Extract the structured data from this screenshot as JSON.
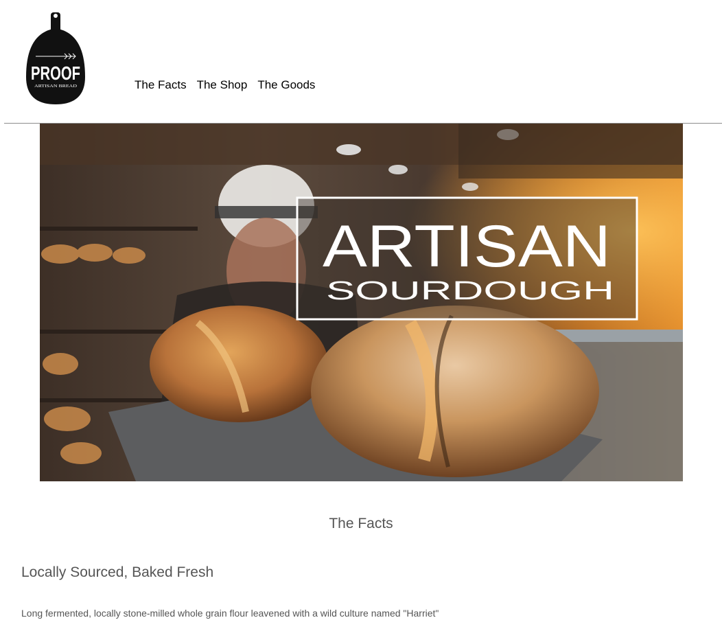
{
  "logo": {
    "brand": "PROOF",
    "tagline": "ARTISAN BREAD",
    "icon": "bread-peel-logo"
  },
  "nav": {
    "items": [
      {
        "label": "The Facts"
      },
      {
        "label": "The Shop"
      },
      {
        "label": "The Goods"
      }
    ]
  },
  "hero": {
    "title_line1": "ARTISAN",
    "title_line2": "SOURDOUGH"
  },
  "facts": {
    "heading": "The Facts",
    "subheading": "Locally Sourced, Baked Fresh",
    "body": "Long fermented, locally stone-milled whole grain flour leavened with a wild culture named \"Harriet\""
  },
  "colors": {
    "text_gray": "#555555",
    "rule": "#8c8c8c",
    "logo_black": "#111111"
  }
}
